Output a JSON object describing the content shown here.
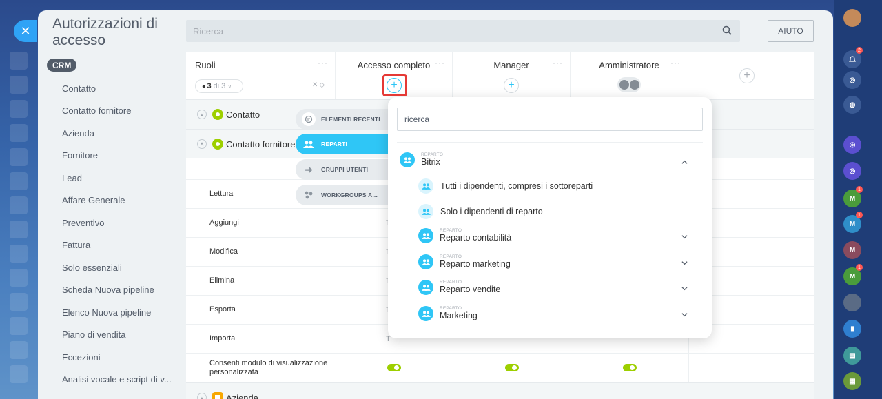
{
  "title": "Autorizzazioni di accesso",
  "search": {
    "placeholder": "Ricerca"
  },
  "help_label": "AIUTO",
  "crm_badge": "CRM",
  "menu": [
    "Contatto",
    "Contatto fornitore",
    "Azienda",
    "Fornitore",
    "Lead",
    "Affare Generale",
    "Preventivo",
    "Fattura",
    "Solo essenziali",
    "Scheda Nuova pipeline",
    "Elenco Nuova pipeline",
    "Piano di vendita",
    "Eccezioni",
    "Analisi vocale e script di v..."
  ],
  "roles": {
    "title": "Ruoli",
    "count": "3",
    "count_suffix": "di 3"
  },
  "columns": [
    {
      "title": "Accesso completo"
    },
    {
      "title": "Manager"
    },
    {
      "title": "Amministratore"
    }
  ],
  "groups": {
    "contatto": "Contatto",
    "fornitore": "Contatto fornitore",
    "azienda": "Azienda"
  },
  "permissions": [
    "Lettura",
    "Aggiungi",
    "Modifica",
    "Elimina",
    "Esporta",
    "Importa"
  ],
  "perm_value": "T",
  "custom_view_label": "Consenti modulo di visualizzazione personalizzata",
  "tabs": [
    "ELEMENTI RECENTI",
    "REPARTI",
    "GRUPPI UTENTI",
    "WORKGROUPS A..."
  ],
  "popup": {
    "search_placeholder": "ricerca",
    "root": {
      "small": "REPARTO",
      "name": "Bitrix"
    },
    "options": [
      "Tutti i dipendenti, compresi i sottoreparti",
      "Solo i dipendenti di reparto"
    ],
    "departments": [
      {
        "small": "REPARTO",
        "name": "Reparto contabilità"
      },
      {
        "small": "REPARTO",
        "name": "Reparto marketing"
      },
      {
        "small": "REPARTO",
        "name": "Reparto vendite"
      },
      {
        "small": "REPARTO",
        "name": "Marketing"
      }
    ]
  },
  "rail": {
    "badges": [
      "2",
      "1",
      "1",
      "1"
    ],
    "avatar_letter": "M"
  },
  "colors": {
    "accent": "#2fc6f6",
    "toggle_on": "#9dcf00",
    "highlight": "#e53935"
  }
}
